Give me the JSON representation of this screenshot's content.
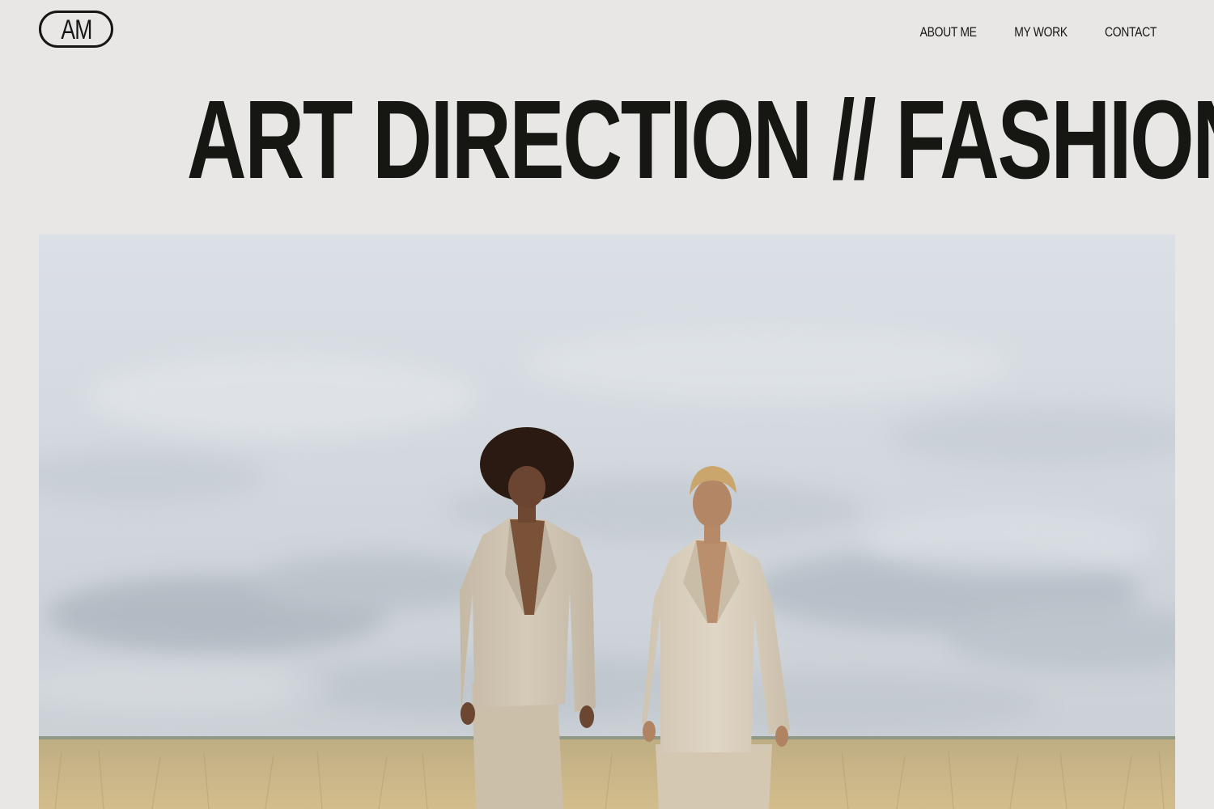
{
  "header": {
    "logo_text": "AM",
    "nav": [
      {
        "label": "ABOUT ME"
      },
      {
        "label": "MY WORK"
      },
      {
        "label": "CONTACT"
      }
    ]
  },
  "hero": {
    "title": "ART DIRECTION // FASHION"
  },
  "photo": {
    "subject": "two models in beige suits standing in a wheat field under a cloudy sky"
  },
  "colors": {
    "background": "#e8e7e5",
    "text": "#161612",
    "sky_top": "#d9dde2",
    "sky_bottom": "#c4cbd2",
    "field": "#cdb78a",
    "suit": "#d6cbb8"
  }
}
